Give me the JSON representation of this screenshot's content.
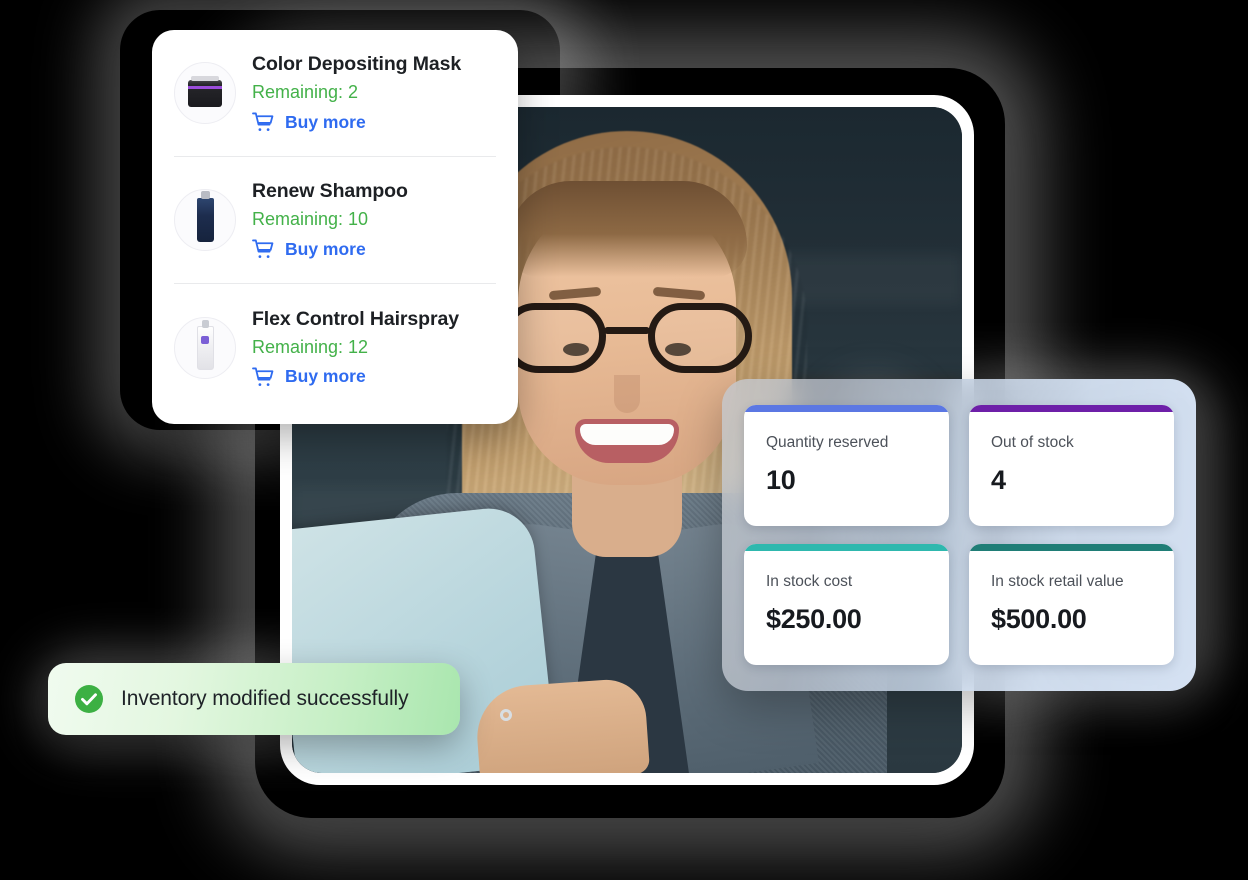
{
  "background": {
    "color": "#000000"
  },
  "product_list": {
    "name": "low-stock-product-list",
    "items": [
      {
        "name": "Color Depositing Mask",
        "remaining_label": "Remaining: 2",
        "remaining_count": 2,
        "buy_label": "Buy more",
        "thumbnail": "jar-dark-purple",
        "cart_icon": "shopping-cart-icon"
      },
      {
        "name": "Renew Shampoo",
        "remaining_label": "Remaining: 10",
        "remaining_count": 10,
        "buy_label": "Buy more",
        "thumbnail": "bottle-navy",
        "cart_icon": "shopping-cart-icon"
      },
      {
        "name": "Flex Control Hairspray",
        "remaining_label": "Remaining: 12",
        "remaining_count": 12,
        "buy_label": "Buy more",
        "thumbnail": "bottle-white",
        "cart_icon": "shopping-cart-icon"
      }
    ],
    "colors": {
      "remaining_text": "#43b149",
      "buy_more_text": "#2f6bf0",
      "title_text": "#1d2024",
      "divider": "#e9eaec"
    }
  },
  "stats_panel": {
    "name": "inventory-stats-panel",
    "cards": [
      {
        "label": "Quantity reserved",
        "value": "10",
        "accent": "#5b77e3"
      },
      {
        "label": "Out of stock",
        "value": "4",
        "accent": "#6d1fa8"
      },
      {
        "label": "In stock cost",
        "value": "$250.00",
        "accent": "#2eb8ae"
      },
      {
        "label": "In stock retail value",
        "value": "$500.00",
        "accent": "#1f7d76"
      }
    ]
  },
  "toast": {
    "name": "success-toast",
    "message": "Inventory modified successfully",
    "icon": "check-circle-icon",
    "icon_color": "#3cb043",
    "background_from": "#f0fbef",
    "background_to": "#a9e6ae"
  },
  "photo": {
    "name": "hero-photo-card",
    "description": "Smiling woman with glasses working on a laptop"
  }
}
